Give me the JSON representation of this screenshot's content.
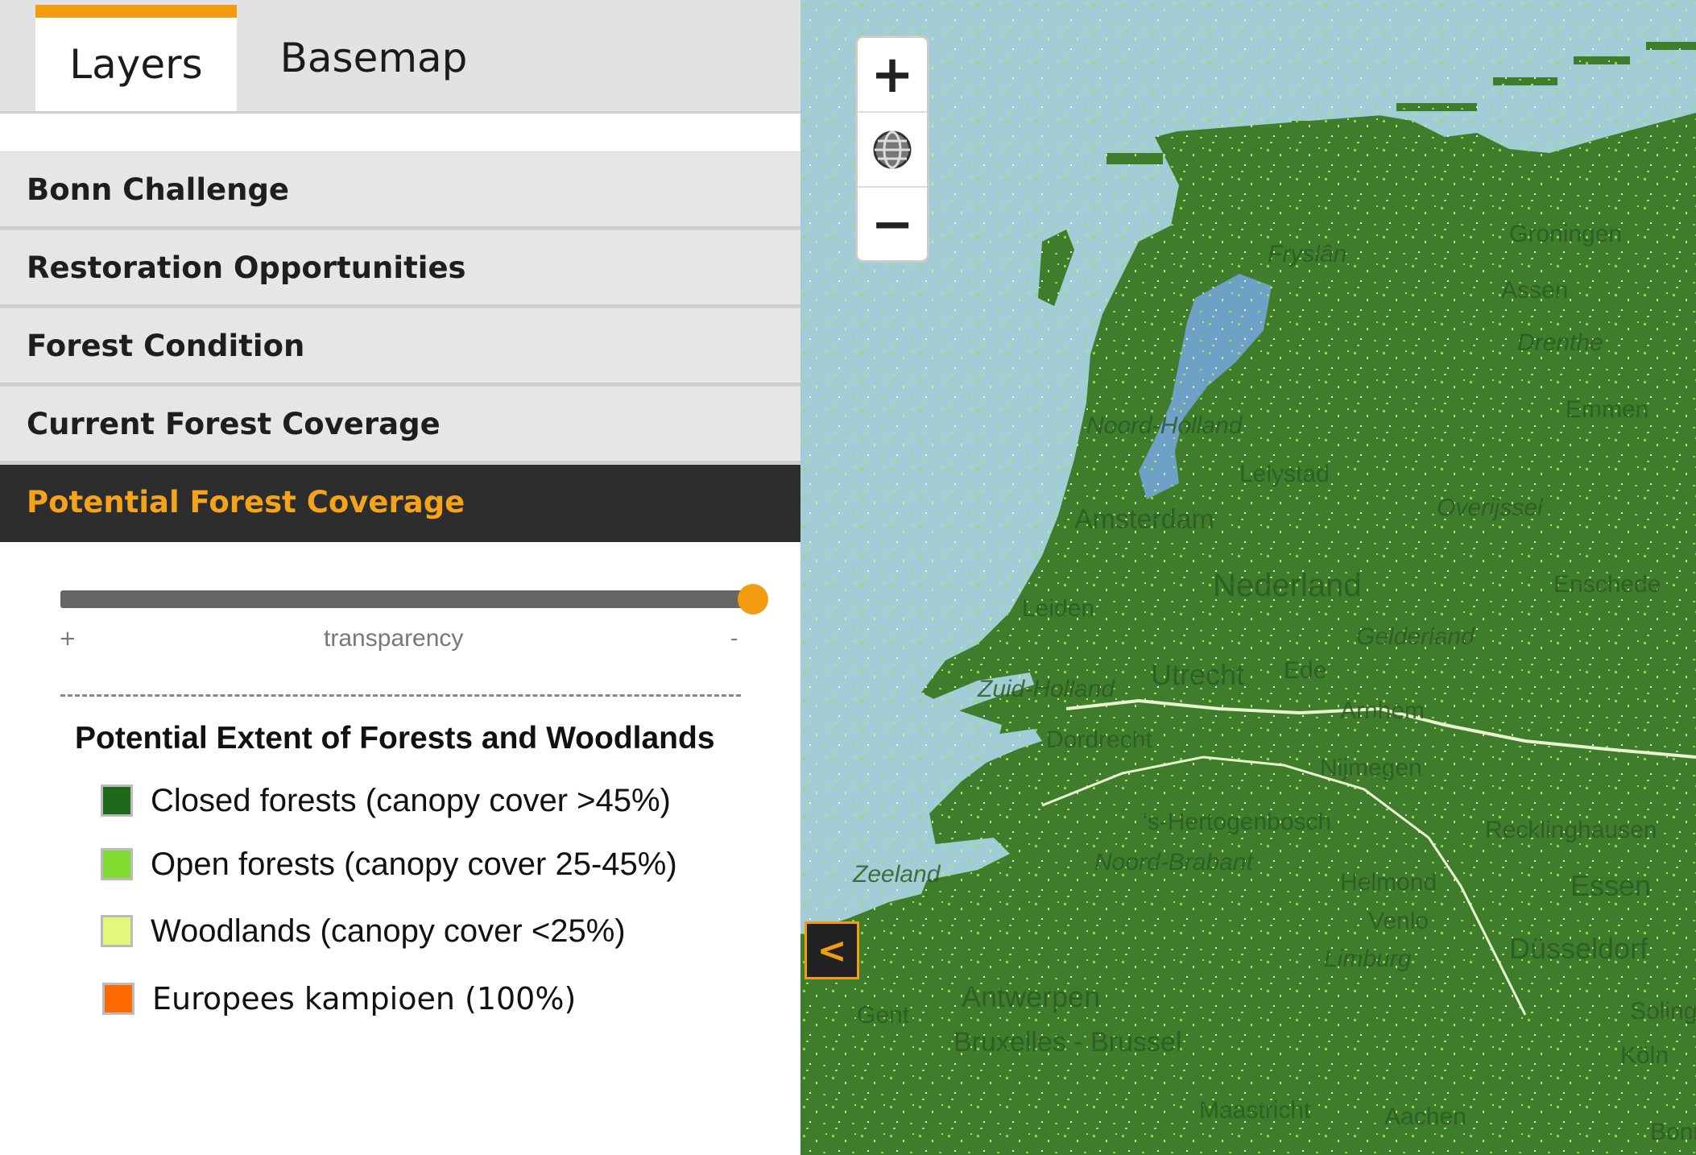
{
  "tabs": [
    {
      "label": "Layers",
      "active": true
    },
    {
      "label": "Basemap",
      "active": false
    }
  ],
  "layers": [
    {
      "label": "Bonn Challenge"
    },
    {
      "label": "Restoration Opportunities"
    },
    {
      "label": "Forest Condition"
    },
    {
      "label": "Current Forest Coverage"
    },
    {
      "label": "Potential Forest Coverage",
      "active": true
    }
  ],
  "transparency": {
    "label": "transparency",
    "plus": "+",
    "minus": "-",
    "value": 1.0
  },
  "legend": {
    "title": "Potential Extent of Forests and Woodlands",
    "items": [
      {
        "label": "Closed forests (canopy cover >45%)",
        "color": "#1d6b1a"
      },
      {
        "label": "Open forests (canopy cover 25-45%)",
        "color": "#7fdb2f"
      },
      {
        "label": "Woodlands (canopy cover <25%)",
        "color": "#e4f77a"
      },
      {
        "label": "Europees kampioen (100%)",
        "color": "#ff6a00"
      }
    ]
  },
  "map": {
    "zoom_in": "+",
    "zoom_out": "−",
    "globe_icon": "globe-icon",
    "collapse": "<",
    "colors": {
      "sea": "#a3cdd6",
      "forest": "#3f7d2c",
      "lake": "#6fa0c6"
    },
    "labels": [
      "Groningen",
      "Assen",
      "Drenthe",
      "Emmen",
      "Fryslân",
      "Noord-Holland",
      "Lelystad",
      "Amsterdam",
      "Overijssel",
      "Nederland",
      "Enschede",
      "Leiden",
      "Gelderland",
      "Utrecht",
      "Ede",
      "Zuid-Holland",
      "Arnhem",
      "Dordrecht",
      "Nijmegen",
      "'s-Hertogenbosch",
      "Recklinghausen",
      "Noord-Brabant",
      "Zeeland",
      "Helmond",
      "Essen",
      "Venlo",
      "Düsseldorf",
      "Limburg",
      "Gent",
      "Antwerpen",
      "Solingen",
      "Bruxelles - Brussel",
      "Köln",
      "Maastricht",
      "Aachen",
      "Bonn"
    ]
  }
}
